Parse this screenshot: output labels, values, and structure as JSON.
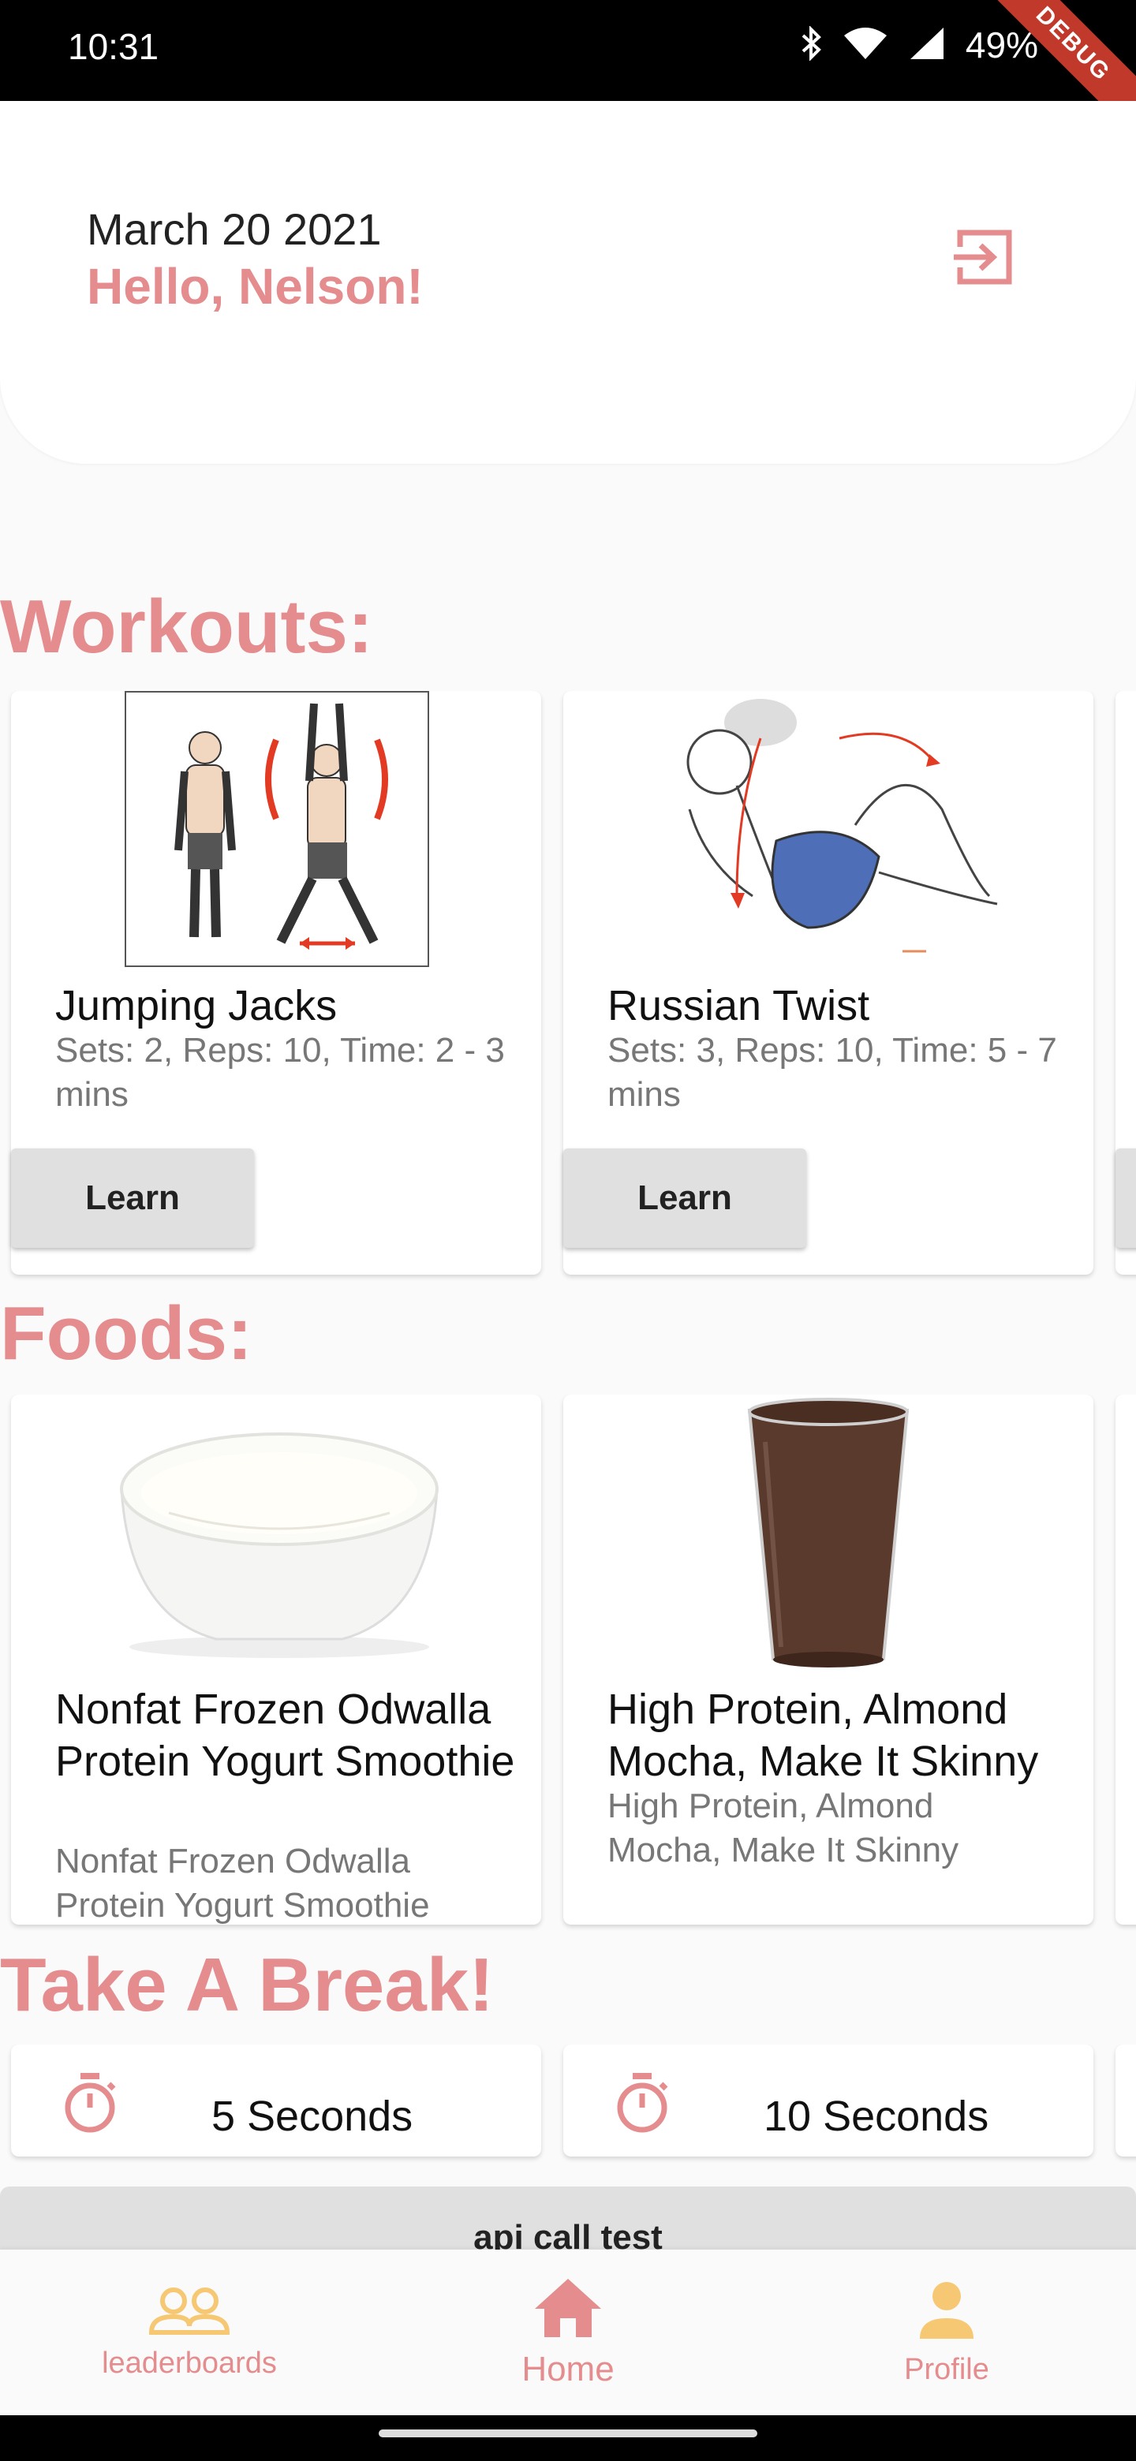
{
  "status_bar": {
    "time": "10:31",
    "battery": "49%",
    "debug_label": "DEBUG"
  },
  "header": {
    "date": "March 20 2021",
    "greeting": "Hello, Nelson!"
  },
  "workouts": {
    "title": "Workouts:",
    "items": [
      {
        "name": "Jumping Jacks",
        "details": "Sets: 2, Reps: 10, Time: 2 - 3 mins",
        "button": "Learn"
      },
      {
        "name": "Russian Twist",
        "details": "Sets: 3, Reps: 10, Time: 5 - 7 mins",
        "button": "Learn"
      }
    ]
  },
  "foods": {
    "title": "Foods:",
    "items": [
      {
        "name": "Nonfat Frozen Odwalla Protein Yogurt Smoothie",
        "details": "Nonfat Frozen Odwalla Protein Yogurt Smoothie"
      },
      {
        "name": "High Protein, Almond Mocha, Make It Skinny",
        "details": "High Protein, Almond Mocha, Make It Skinny"
      }
    ]
  },
  "break": {
    "title": "Take A Break!",
    "timers": [
      {
        "label": "5 Seconds",
        "icon": "timer-icon"
      },
      {
        "label": "10 Seconds",
        "icon": "timer-icon"
      }
    ]
  },
  "api_button": {
    "label": "api call test"
  },
  "bottom_nav": {
    "items": [
      {
        "label": "leaderboards",
        "icon": "group-icon"
      },
      {
        "label": "Home",
        "icon": "home-icon",
        "active": true
      },
      {
        "label": "Profile",
        "icon": "person-icon"
      }
    ]
  },
  "colors": {
    "accent": "#e48c8e",
    "nav_icon_yellow": "#f7c873",
    "timer_icon": "#e48c8e"
  }
}
